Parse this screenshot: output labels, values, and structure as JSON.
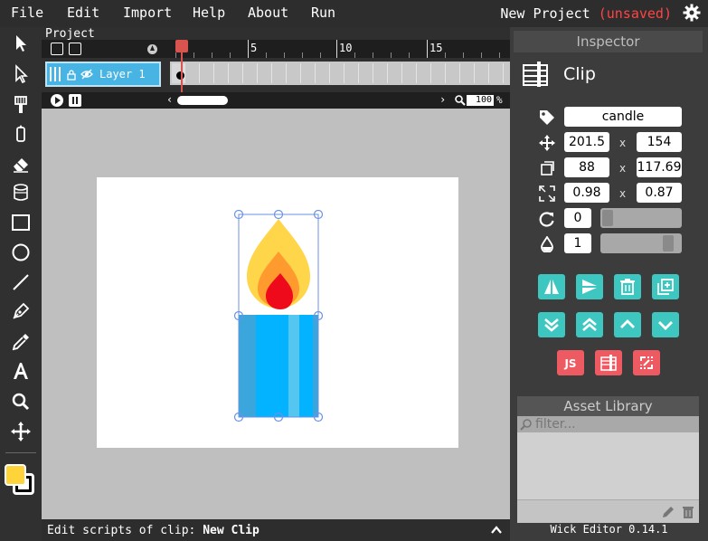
{
  "menubar": {
    "items": [
      "File",
      "Edit",
      "Import",
      "Help",
      "About",
      "Run"
    ],
    "project_name": "New Project",
    "unsaved": "(unsaved)"
  },
  "toolbar": {
    "tools": [
      "cursor-icon",
      "path-cursor-icon",
      "brush-icon",
      "pencil-icon",
      "eraser-icon",
      "fill-bucket-icon",
      "rectangle-icon",
      "ellipse-icon",
      "line-icon",
      "pen-icon",
      "eyedropper-icon",
      "text-icon",
      "zoom-icon",
      "pan-icon"
    ],
    "fill_color": "#ffd43b",
    "stroke_color": "#000000"
  },
  "timeline": {
    "title": "Project",
    "ruler_labels": [
      "5",
      "10",
      "15"
    ],
    "layer_name": "Layer 1",
    "zoom": "100",
    "zoom_unit": "%"
  },
  "scripts_bar": {
    "prefix": "Edit scripts of clip:",
    "clip_name": "New Clip"
  },
  "inspector": {
    "title": "Inspector",
    "object_type": "Clip",
    "name": "candle",
    "x": "201.5",
    "y": "154",
    "width": "88",
    "height": "117.69",
    "scale_x": "0.98",
    "scale_y": "0.87",
    "rotation": "0",
    "opacity": "1",
    "opacity_level": 0.9,
    "rotation_level": 0.0,
    "x_separator": "x"
  },
  "asset_library": {
    "title": "Asset Library",
    "filter_placeholder": "filter..."
  },
  "version": "Wick Editor 0.14.1",
  "colors": {
    "accent_teal": "#3ec6c0",
    "accent_coral": "#ee5a62",
    "layer_blue": "#48b4e4",
    "playhead_red": "#d9534f",
    "unsaved_red": "#ff4444"
  }
}
